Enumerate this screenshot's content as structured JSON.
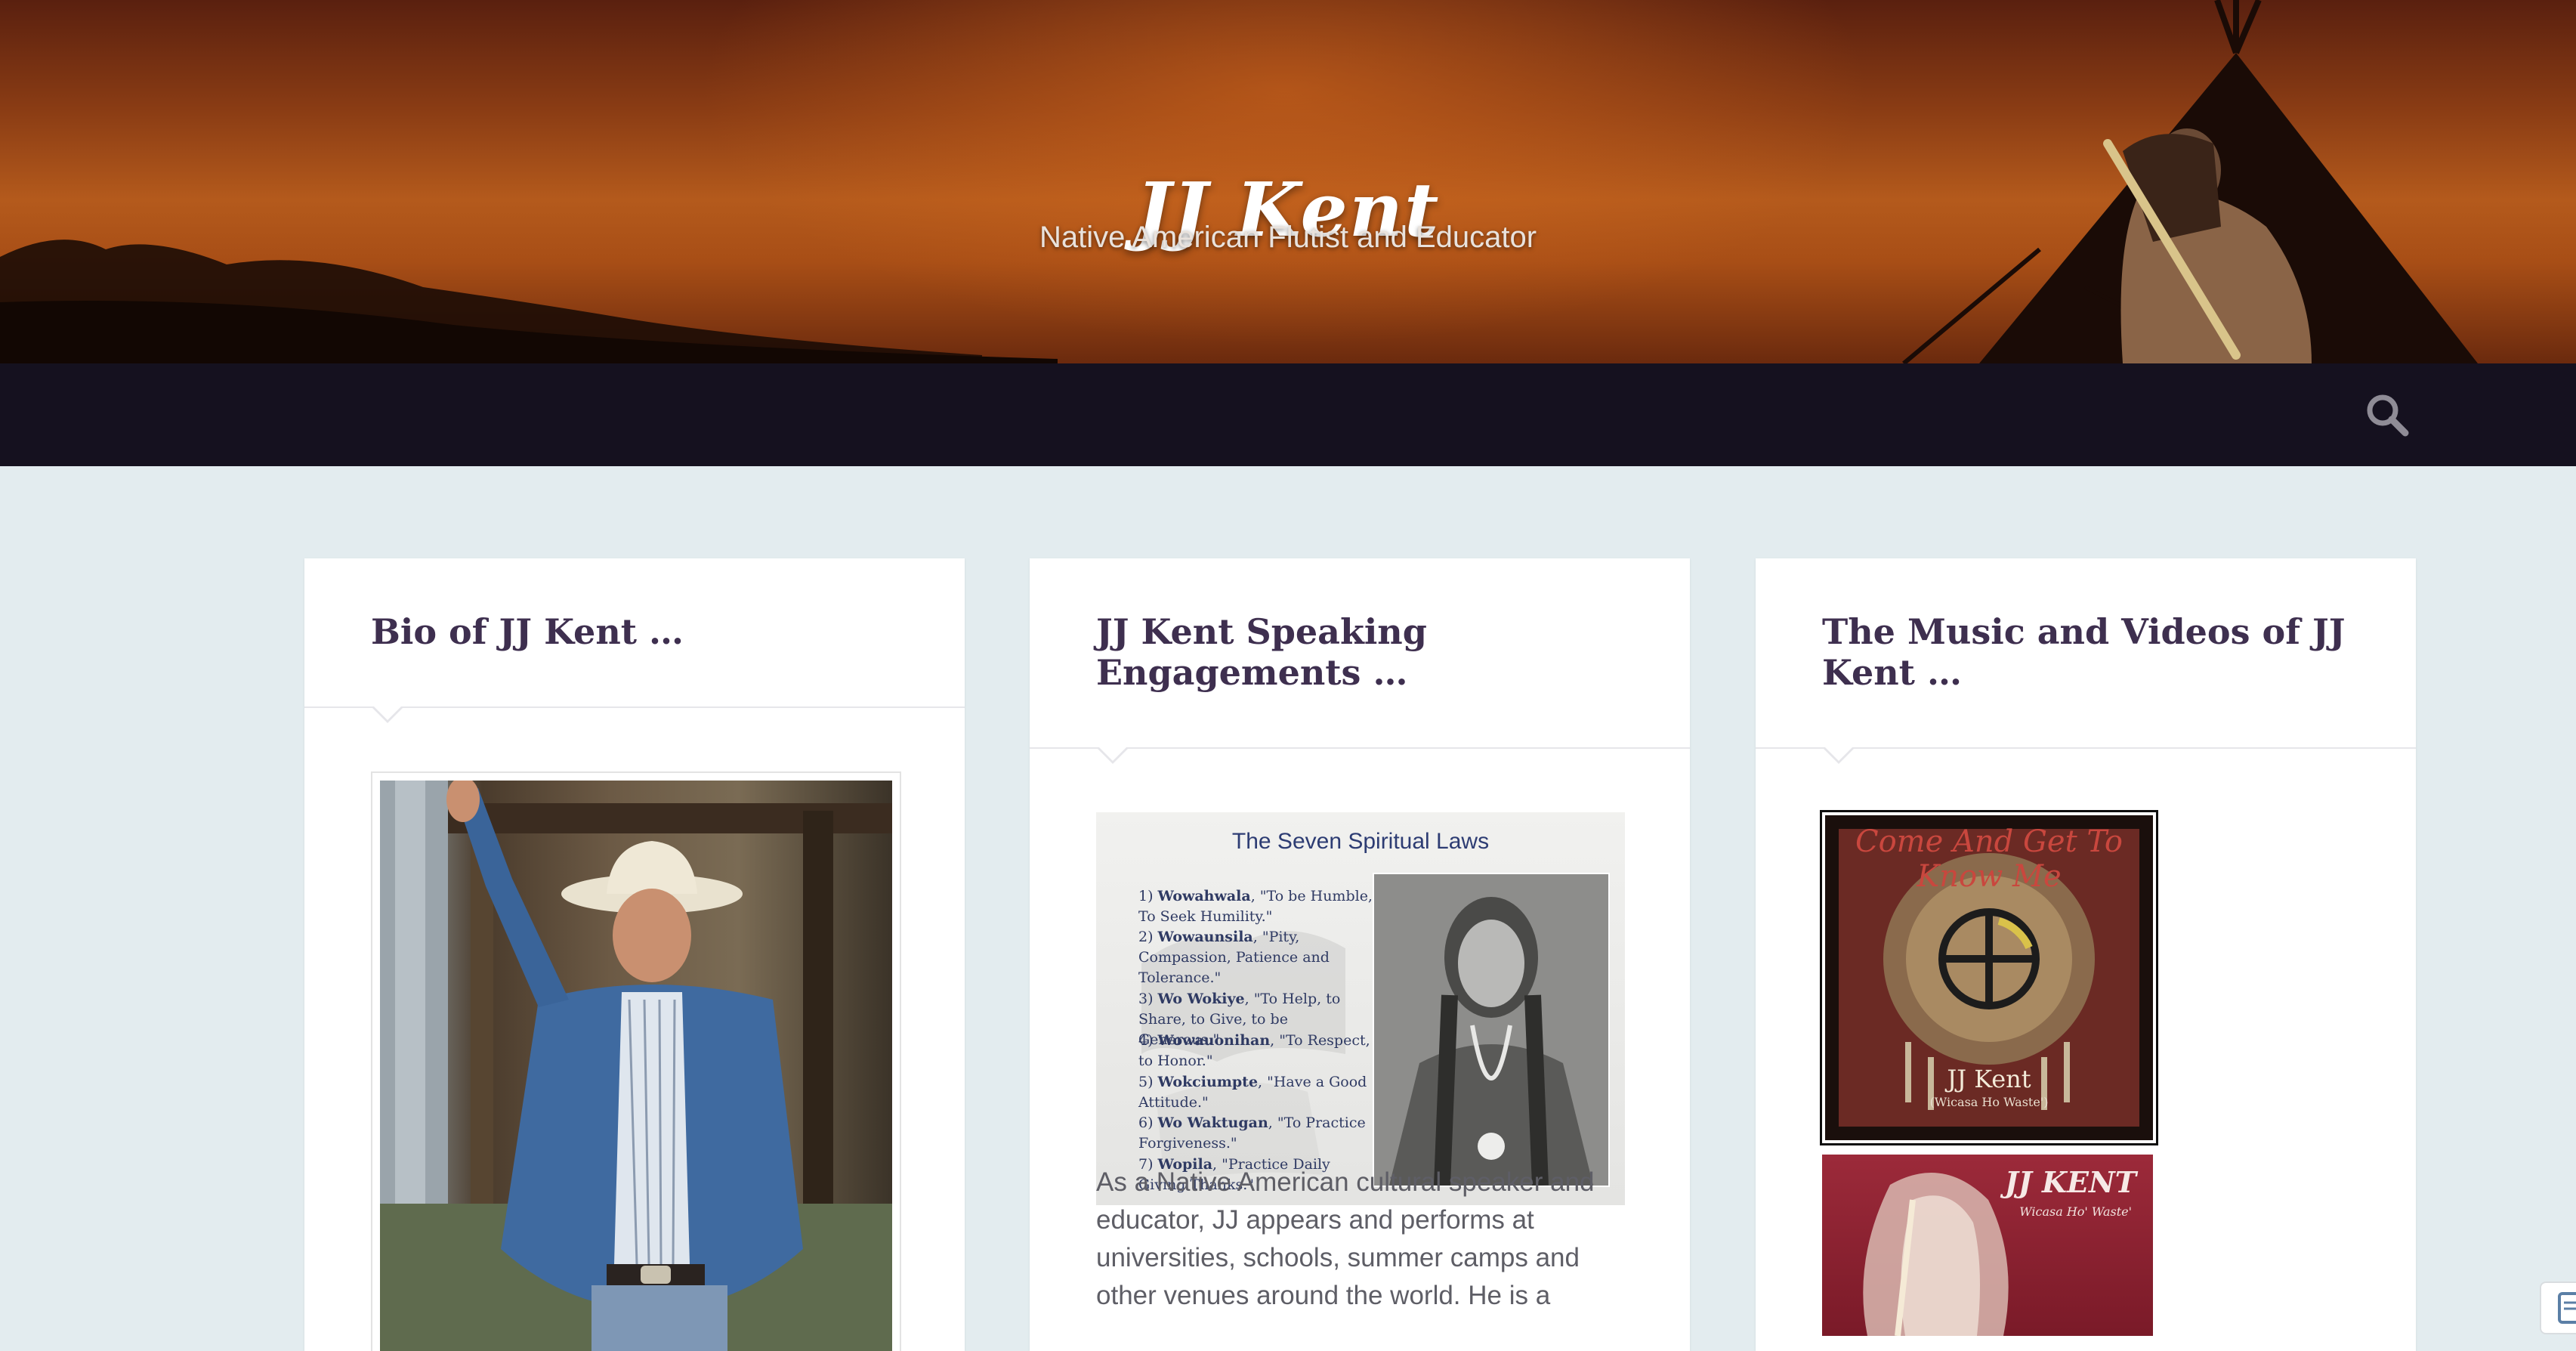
{
  "site": {
    "title": "JJ Kent",
    "tagline": "Native American Flutist and Educator"
  },
  "nav": {
    "search_icon": "search-icon"
  },
  "posts": [
    {
      "title": "Bio of JJ Kent …",
      "image": "jj-kent-photo"
    },
    {
      "title": "JJ Kent Speaking Engagements …",
      "image": "seven-spiritual-laws-poster",
      "poster": {
        "title": "The Seven Spiritual Laws",
        "laws": [
          {
            "num": "1) ",
            "name": "Wowahwala",
            "text": ", \"To be Humble, To Seek Humility.\""
          },
          {
            "num": "2) ",
            "name": "Wowaunsila",
            "text": ", \"Pity, Compassion, Patience and Tolerance.\""
          },
          {
            "num": "3) ",
            "name": "Wo Wokiye",
            "text": ", \"To Help, to Share, to Give, to be Generous.\""
          },
          {
            "num": "4) ",
            "name": "Wowauonihan",
            "text": ", \"To Respect, to Honor.\""
          },
          {
            "num": "5) ",
            "name": "Wokciumpte",
            "text": ", \"Have a Good Attitude.\""
          },
          {
            "num": "6) ",
            "name": "Wo Waktugan",
            "text": ", \"To Practice Forgiveness.\""
          },
          {
            "num": "7) ",
            "name": "Wopila",
            "text": ", \"Practice Daily Giving Thanks.\""
          }
        ]
      },
      "excerpt": "As a Native American cultural speaker and educator, JJ appears and performs at universities, schools, summer camps and other venues around the world.  He is a"
    },
    {
      "title": "The Music and Videos of JJ Kent …",
      "albums": [
        {
          "title": "Come And Get To Know Me",
          "artist": "JJ Kent",
          "sub": "(Wicasa Ho Waste')"
        },
        {
          "title": "JJ KENT",
          "sub": "Wicasa Ho' Waste'"
        }
      ]
    }
  ],
  "colors": {
    "nav_bg": "#15111f",
    "page_bg": "#e3ecef",
    "title_color": "#3e2f4f",
    "text_color": "#5e5e66"
  }
}
